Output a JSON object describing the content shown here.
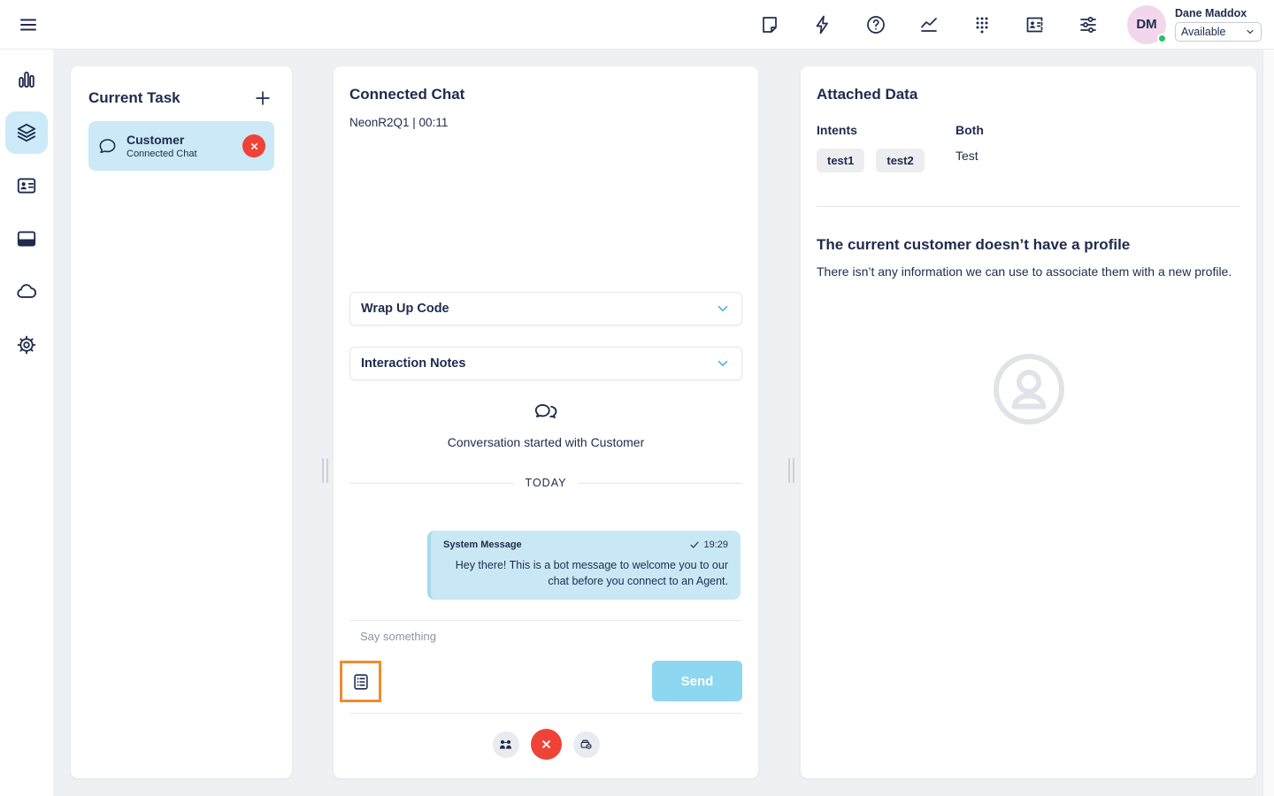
{
  "topbar": {
    "menu_icon": "hamburger-menu-icon",
    "icons": [
      "notes-icon",
      "quick-actions-icon",
      "help-icon",
      "analytics-icon",
      "dialpad-icon",
      "directory-icon",
      "preferences-icon"
    ],
    "user": {
      "initials": "DM",
      "name": "Dane Maddox",
      "status": "Available",
      "presence": "online"
    }
  },
  "sidebar": {
    "items": [
      "dashboard-icon",
      "interactions-icon",
      "contacts-icon",
      "apps-icon",
      "cloud-icon",
      "settings-icon"
    ],
    "active": "interactions-icon"
  },
  "current_task": {
    "title": "Current Task",
    "task_name": "Customer",
    "task_type": "Connected Chat"
  },
  "chat": {
    "title": "Connected Chat",
    "meta": "NeonR2Q1 | 00:11",
    "wrap_up_label": "Wrap Up Code",
    "notes_label": "Interaction Notes",
    "started_text": "Conversation started with Customer",
    "day_divider": "TODAY",
    "message": {
      "sender": "System Message",
      "time": "19:29",
      "text": "Hey there! This is a bot message to welcome you to our chat before you connect to an Agent."
    },
    "input_placeholder": "Say something",
    "send_label": "Send"
  },
  "attached_data": {
    "title": "Attached Data",
    "intents_label": "Intents",
    "intents": [
      "test1",
      "test2"
    ],
    "both_label": "Both",
    "both_value": "Test",
    "no_profile_title": "The current customer doesn’t have a profile",
    "no_profile_text": "There isn’t any information we can use to associate them with a new profile."
  },
  "colors": {
    "navy": "#1f2b4d",
    "selection_blue": "#cbe9f7",
    "bubble_blue": "#c9e8f6",
    "send_blue": "#8dd7f0",
    "chevron_blue": "#58b4df",
    "highlight_orange": "#ef8b2d",
    "alert_red": "#ef4337",
    "status_green": "#27c160",
    "avatar_pink": "#f2d7ec",
    "page_bg": "#eef0f3"
  }
}
